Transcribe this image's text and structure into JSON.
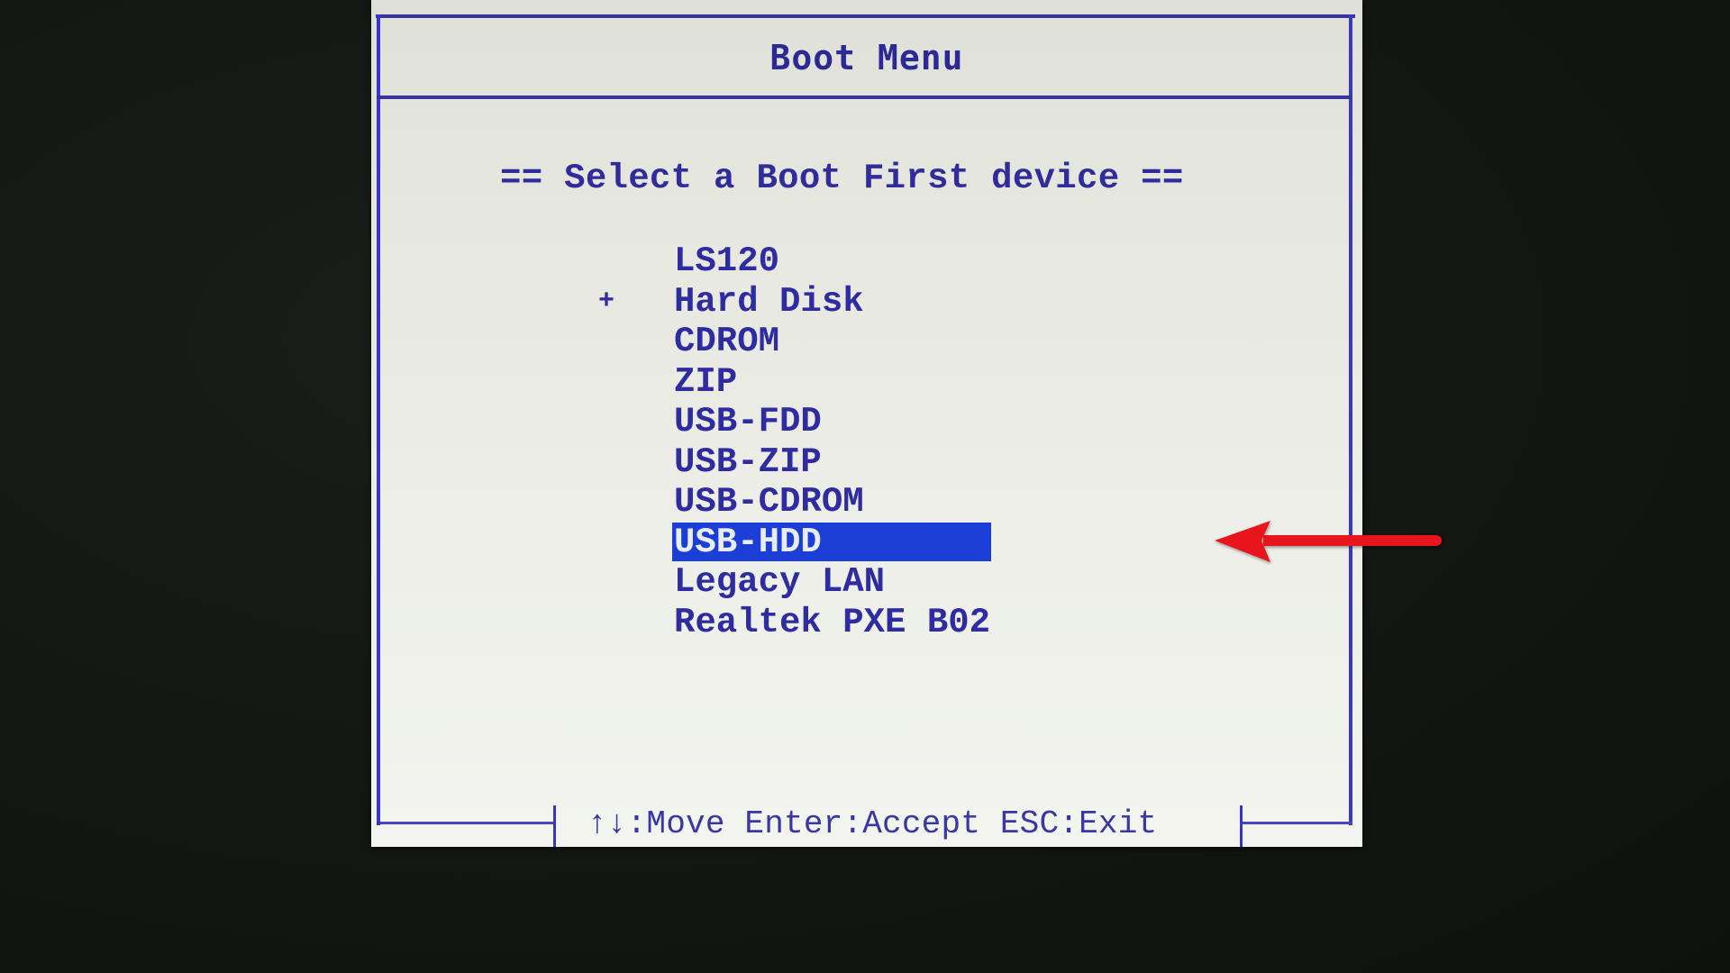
{
  "bios": {
    "title": "Boot Menu",
    "subtitle": "== Select a Boot First device ==",
    "items": [
      {
        "label": "LS120",
        "marker": "",
        "selected": false
      },
      {
        "label": "Hard Disk",
        "marker": "+",
        "selected": false
      },
      {
        "label": "CDROM",
        "marker": "",
        "selected": false
      },
      {
        "label": "ZIP",
        "marker": "",
        "selected": false
      },
      {
        "label": "USB-FDD",
        "marker": "",
        "selected": false
      },
      {
        "label": "USB-ZIP",
        "marker": "",
        "selected": false
      },
      {
        "label": "USB-CDROM",
        "marker": "",
        "selected": false
      },
      {
        "label": "USB-HDD",
        "marker": "",
        "selected": true
      },
      {
        "label": "Legacy LAN",
        "marker": "",
        "selected": false
      },
      {
        "label": "Realtek PXE B02",
        "marker": "",
        "selected": false
      }
    ],
    "footer": "↑↓:Move Enter:Accept ESC:Exit",
    "annotation": {
      "type": "arrow-left",
      "points_to": "USB-HDD"
    }
  },
  "colors": {
    "text": "#2f2ba0",
    "frame": "#3b36c8",
    "highlight": "#1b3fd6",
    "highlight_text": "#e8ecf8",
    "annotation_arrow": "#e8141a",
    "background": "#141612",
    "panel": "#e6e7df"
  }
}
